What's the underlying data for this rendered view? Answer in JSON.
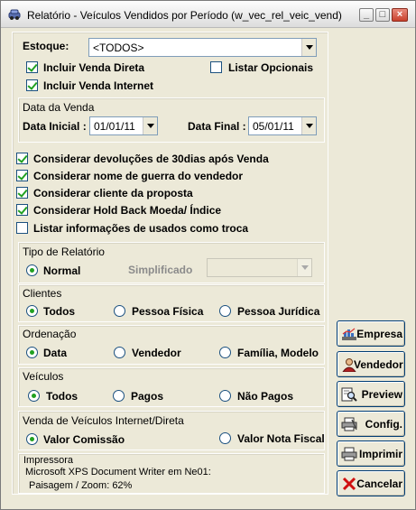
{
  "window": {
    "title": "Relatório - Veículos Vendidos por Período (w_vec_rel_veic_vend)"
  },
  "estoque": {
    "label": "Estoque:",
    "value": "<TODOS>"
  },
  "options_top": {
    "incluir_venda_direta": {
      "label": "Incluir Venda Direta",
      "checked": true
    },
    "listar_opcionais": {
      "label": "Listar Opcionais",
      "checked": false
    },
    "incluir_venda_internet": {
      "label": "Incluir Venda Internet",
      "checked": true
    }
  },
  "data_venda": {
    "title": "Data da Venda",
    "inicial_label": "Data Inicial :",
    "inicial_value": "01/01/11",
    "final_label": "Data Final :",
    "final_value": "05/01/11"
  },
  "considerar": {
    "devolucoes": {
      "label": "Considerar devoluções  de 30dias após Venda",
      "checked": true
    },
    "nome_guerra": {
      "label": "Considerar nome de guerra do vendedor",
      "checked": true
    },
    "cliente_proposta": {
      "label": "Considerar cliente da proposta",
      "checked": true
    },
    "hold_back": {
      "label": "Considerar Hold Back  Moeda/ Índice",
      "checked": true
    },
    "usados_troca": {
      "label": "Listar informações de usados como troca",
      "checked": false
    }
  },
  "tipo_relatorio": {
    "title": "Tipo de Relatório",
    "normal": "Normal",
    "simplificado": "Simplificado",
    "selected": "Normal"
  },
  "clientes": {
    "title": "Clientes",
    "todos": "Todos",
    "pessoa_fisica": "Pessoa Física",
    "pessoa_juridica": "Pessoa Jurídica",
    "selected": "Todos"
  },
  "ordenacao": {
    "title": "Ordenação",
    "data": "Data",
    "vendedor": "Vendedor",
    "familia_modelo": "Família, Modelo",
    "selected": "Data"
  },
  "veiculos": {
    "title": "Veículos",
    "todos": "Todos",
    "pagos": "Pagos",
    "nao_pagos": "Não Pagos",
    "selected": "Todos"
  },
  "venda_internet": {
    "title": "Venda de Veículos Internet/Direta",
    "valor_comissao": "Valor Comissão",
    "valor_nota_fiscal": "Valor Nota Fiscal",
    "selected": "Valor Comissão"
  },
  "impressora": {
    "title": "Impressora",
    "line1": "Microsoft XPS Document Writer em Ne01:",
    "line2": "Paisagem / Zoom: 62%"
  },
  "buttons": {
    "empresa": {
      "label": "Empresa",
      "icon": "building-chart-icon"
    },
    "vendedor": {
      "label": "Vendedor",
      "icon": "person-icon"
    },
    "preview": {
      "label": "Preview",
      "icon": "magnifier-document-icon"
    },
    "config": {
      "label": "Config.",
      "icon": "printer-config-icon"
    },
    "imprimir": {
      "label": "Imprimir",
      "icon": "printer-icon"
    },
    "cancelar": {
      "label": "Cancelar",
      "icon": "red-x-icon"
    }
  },
  "colors": {
    "accent": "#21a121",
    "face": "#ECE9D8",
    "border": "#1c5180"
  }
}
